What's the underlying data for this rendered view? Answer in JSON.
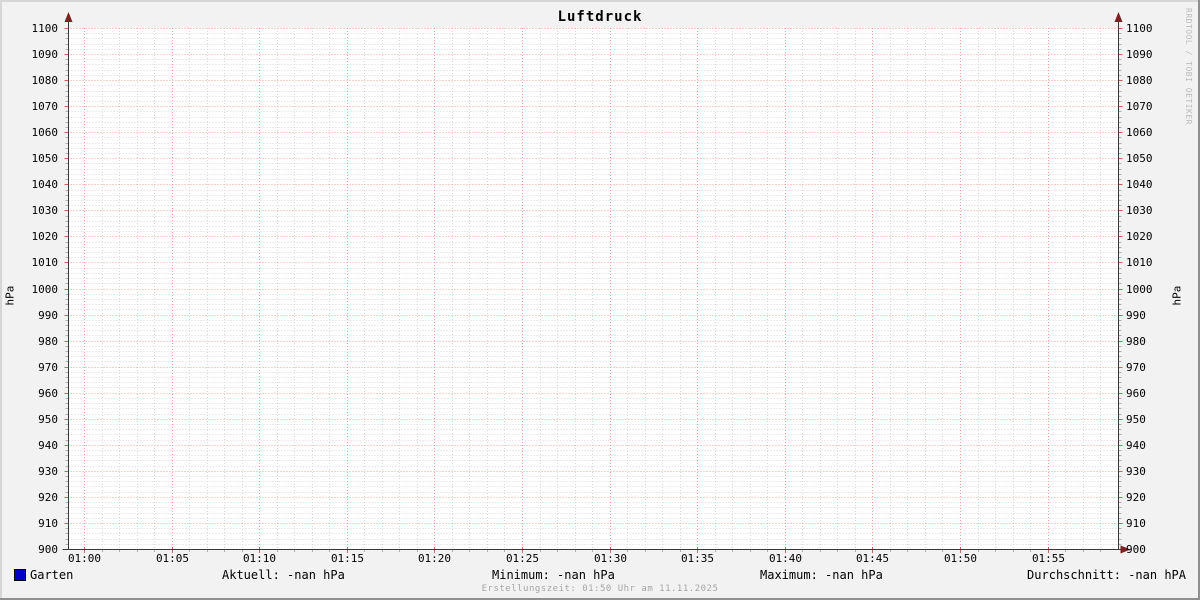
{
  "title": "Luftdruck",
  "watermark": "RRDTOOL / TOBI OETIKER",
  "y_axis": {
    "unit": "hPa",
    "min": 900,
    "max": 1100,
    "major_step": 10,
    "minor_step": 2
  },
  "x_axis": {
    "labels": [
      "01:00",
      "01:05",
      "01:10",
      "01:15",
      "01:20",
      "01:25",
      "01:30",
      "01:35",
      "01:40",
      "01:45",
      "01:50",
      "01:55"
    ],
    "minutes_per_minor": 1,
    "minors_per_major": 5,
    "total_minor_lines": 59
  },
  "legend": {
    "series_label": "Garten",
    "aktuell": "Aktuell: -nan hPa",
    "minimum": "Minimum: -nan hPa",
    "maximum": "Maximum: -nan hPa",
    "durchschnitt": "Durchschnitt: -nan hPA",
    "footer": "Erstellungszeit: 01:50 Uhr am 11.11.2025"
  },
  "colors": {
    "background": "#f2f2f2",
    "canvas": "#ffffff",
    "grid_major": "#f0a2a2",
    "grid_minor": "#d9d9d9",
    "tick_major": "#cf6060",
    "tick_minor": "#b0b0b0",
    "axis": "#383838",
    "arrow": "#7d2222",
    "series": "#0000c8"
  },
  "chart_data": {
    "type": "line",
    "title": "Luftdruck",
    "ylabel": "hPa",
    "ylim": [
      900,
      1100
    ],
    "y_major_step": 10,
    "y_minor_step": 2,
    "x_ticks": [
      "01:00",
      "01:05",
      "01:10",
      "01:15",
      "01:20",
      "01:25",
      "01:30",
      "01:35",
      "01:40",
      "01:45",
      "01:50",
      "01:55"
    ],
    "x_minor_step_minutes": 1,
    "grid": true,
    "legend_position": "bottom",
    "series": [
      {
        "name": "Garten",
        "color": "#0000c8",
        "values": []
      }
    ],
    "stats": {
      "aktuell": "-nan hPa",
      "minimum": "-nan hPa",
      "maximum": "-nan hPa",
      "durchschnitt": "-nan hPA"
    }
  }
}
